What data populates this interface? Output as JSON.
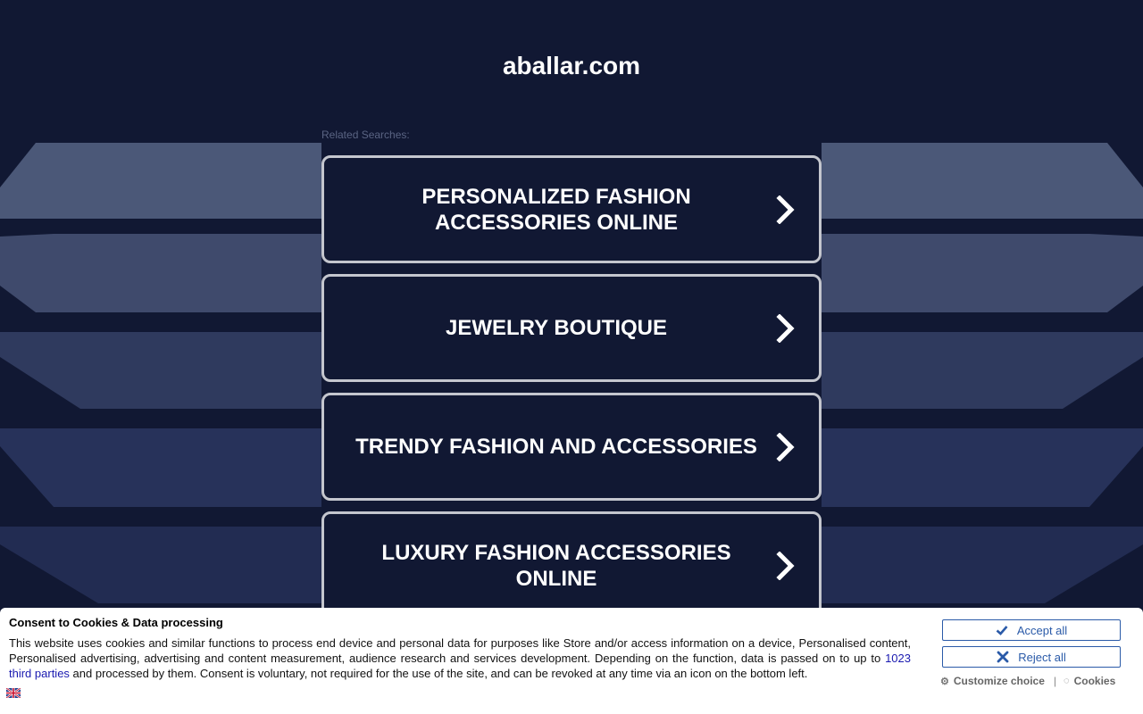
{
  "site": {
    "title": "aballar.com"
  },
  "related": {
    "label": "Related Searches:",
    "items": [
      {
        "label": "PERSONALIZED FASHION ACCESSORIES ONLINE"
      },
      {
        "label": "JEWELRY BOUTIQUE"
      },
      {
        "label": "TRENDY FASHION AND ACCESSORIES"
      },
      {
        "label": "LUXURY FASHION ACCESSORIES ONLINE"
      }
    ]
  },
  "consent": {
    "title": "Consent to Cookies & Data processing",
    "text_before": "This website uses cookies and similar functions to process end device and personal data for purposes like Store and/or access information on a device, Personalised content, Personalised advertising, advertising and content measurement, audience research and services development. Depending on the function, data is passed on to up to ",
    "link_text": "1023 third parties",
    "text_after": " and processed by them. Consent is voluntary, not required for the use of the site, and can be revoked at any time via an icon on the bottom left.",
    "accept_label": "Accept all",
    "reject_label": "Reject all",
    "customize_label": "Customize choice",
    "cookies_label": "Cookies",
    "separator": "|"
  },
  "colors": {
    "background": "#111833",
    "button_border": "#c4c6ce",
    "consent_accent": "#2a5aa8"
  }
}
